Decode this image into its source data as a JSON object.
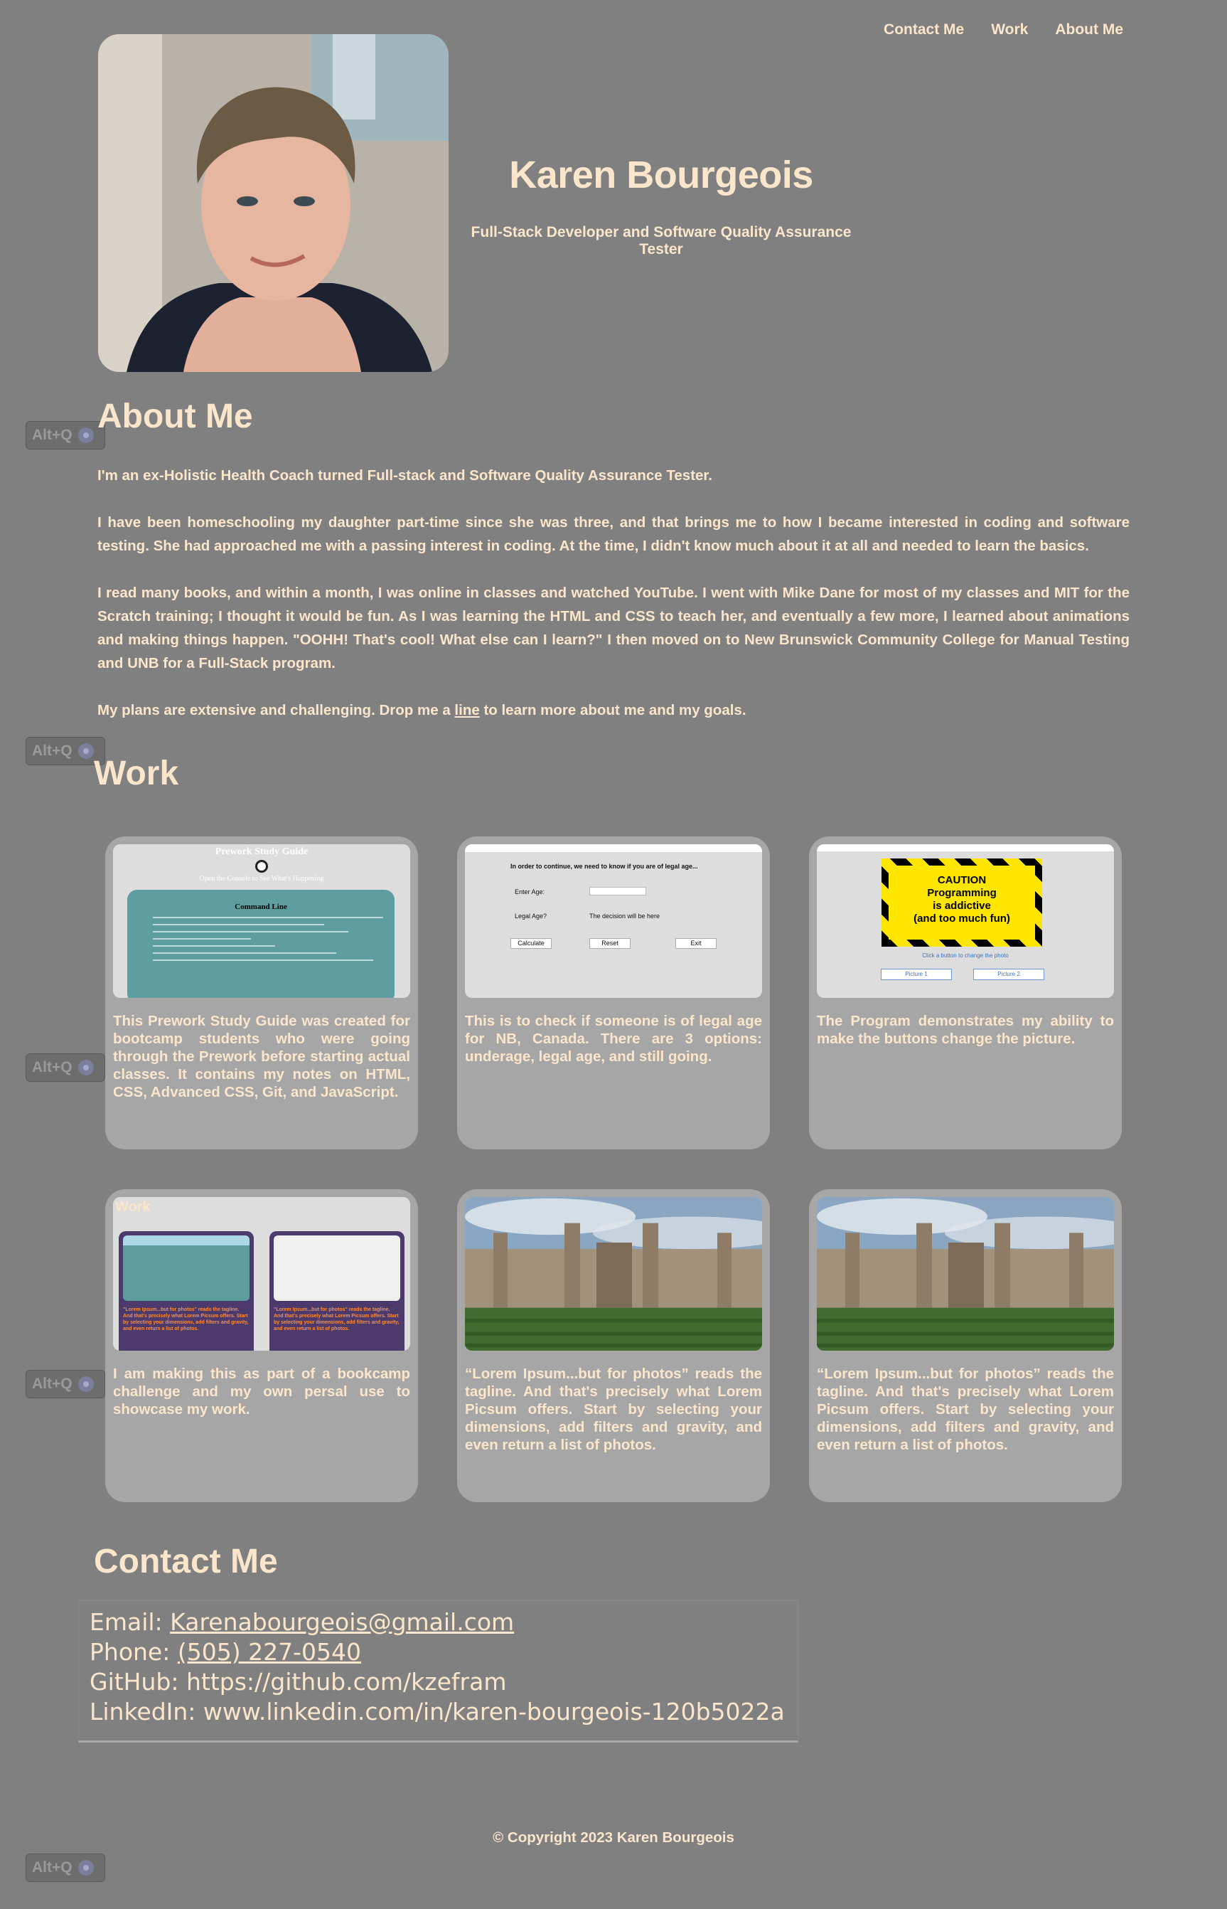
{
  "nav": {
    "items": [
      "Contact Me",
      "Work",
      "About Me"
    ]
  },
  "header": {
    "name": "Karen Bourgeois",
    "tagline": "Full-Stack Developer and Software Quality Assurance Tester"
  },
  "badge": {
    "label": "Alt+Q"
  },
  "about": {
    "title": "About Me",
    "p1": "I'm an ex-Holistic Health Coach turned Full-stack and Software Quality Assurance Tester.",
    "p2": "I have been homeschooling my daughter part-time since she was three, and that brings me to how I became interested in coding and software testing. She had approached me with a passing interest in coding. At the time, I didn't know much about it at all and needed to learn the basics.",
    "p3": "I read many books, and within a month, I was online in classes and watched YouTube. I went with Mike Dane for most of my classes and MIT for the Scratch training; I thought it would be fun. As I was learning the HTML and CSS to teach her, and eventually a few more, I learned about animations and making things happen. \"OOHH! That's cool! What else can I learn?\" I then moved on to New Brunswick Community College for Manual Testing and UNB for a Full-Stack program.",
    "p4_before": "My plans are extensive and challenging. Drop me a ",
    "p4_link": "line",
    "p4_after": " to learn more about me and my goals."
  },
  "work": {
    "title": "Work",
    "cards": [
      {
        "text": "This Prework Study Guide was created for bootcamp students who were going through the Prework before starting actual classes. It contains my notes on HTML, CSS, Advanced CSS, Git, and JavaScript.",
        "shot": {
          "title": "Prework Study Guide",
          "subtitle": "Open the Console to See What's Happening",
          "box_title": "Command Line"
        }
      },
      {
        "text": "This is to check if someone is of legal age for NB, Canada. There are 3 options: underage, legal age, and still going.",
        "shot": {
          "prompt": "In order to continue, we need to know if you are of legal age...",
          "enter_age": "Enter Age:",
          "legal_age": "Legal Age?",
          "decision": "The decision will be here",
          "buttons": [
            "Calculate",
            "Reset",
            "Exit"
          ]
        }
      },
      {
        "text": "The Program demonstrates my ability to make the buttons change the picture.",
        "shot": {
          "sign": [
            "CAUTION",
            "Programming",
            "is addictive",
            "(and too much fun)"
          ],
          "caption": "Click a button to change the photo",
          "buttons": [
            "Picture 1",
            "Picture 2"
          ]
        }
      },
      {
        "text": "I am making this as part of a bookcamp challenge and my own persal use to showcase my work.",
        "shot": {
          "label": "Work",
          "mini_text": "\"Lorem Ipsum...but for photos\" reads the tagline. And that's precisely what Lorem Picsum offers. Start by selecting your dimensions, add filters and gravity, and even return a list of photos."
        }
      },
      {
        "text": "“Lorem Ipsum...but for photos” reads the tagline. And that's precisely what Lorem Picsum offers. Start by selecting your dimensions, add filters and gravity, and even return a list of photos."
      },
      {
        "text": "“Lorem Ipsum...but for photos” reads the tagline. And that's precisely what Lorem Picsum offers. Start by selecting your dimensions, add filters and gravity, and even return a list of photos."
      }
    ]
  },
  "contact": {
    "title": "Contact Me",
    "email_label": "Email: ",
    "email": "Karenabourgeois@gmail.com",
    "phone_label": "Phone: ",
    "phone": "(505) 227-0540",
    "github": "GitHub: https://github.com/kzefram",
    "linkedin": "LinkedIn: www.linkedin.com/in/karen-bourgeois-120b5022a"
  },
  "footer": {
    "copyright": "© Copyright 2023 Karen Bourgeois"
  },
  "colors": {
    "background": "#808080",
    "text": "#fbe6cb",
    "card": "#a6a6a6"
  }
}
